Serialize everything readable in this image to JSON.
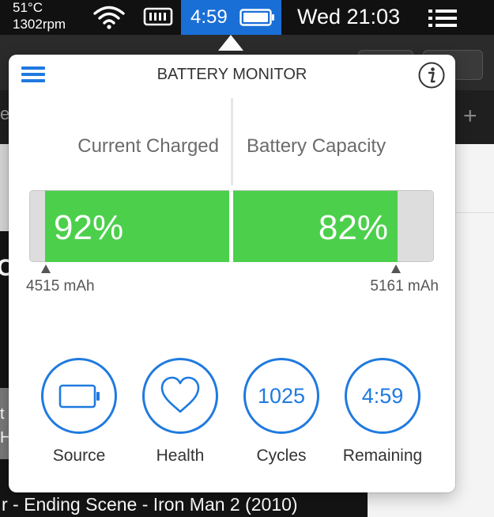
{
  "menubar": {
    "temperature": "51°C",
    "fan_speed": "1302rpm",
    "wifi_icon": "wifi-icon",
    "card_icon": "memory-card-icon",
    "battery_time": "4:59",
    "battery_icon": "battery-icon",
    "clock": "Wed 21:03",
    "list_icon": "list-icon"
  },
  "background": {
    "video_title": "r - Ending Scene - Iron Man 2 (2010)",
    "edge_e": "e",
    "edge_c": "C",
    "edge_t": "t",
    "edge_h": "H",
    "plus_icon": "+"
  },
  "popover": {
    "title": "BATTERY MONITOR",
    "menu_icon": "hamburger-menu-icon",
    "info_icon": "info-icon",
    "current_charged_label": "Current Charged",
    "battery_capacity_label": "Battery Capacity",
    "charged_percent": "92%",
    "capacity_percent": "82%",
    "charged_fraction": 0.92,
    "capacity_fraction": 0.82,
    "current_mah": "4515 mAh",
    "full_mah": "5161 mAh",
    "accent_color": "#1f7ae0",
    "fill_color": "#4cd04c",
    "stats": [
      {
        "label": "Source",
        "icon": "battery-icon"
      },
      {
        "label": "Health",
        "icon": "heart-icon"
      },
      {
        "label": "Cycles",
        "value": "1025"
      },
      {
        "label": "Remaining",
        "value": "4:59"
      }
    ]
  }
}
